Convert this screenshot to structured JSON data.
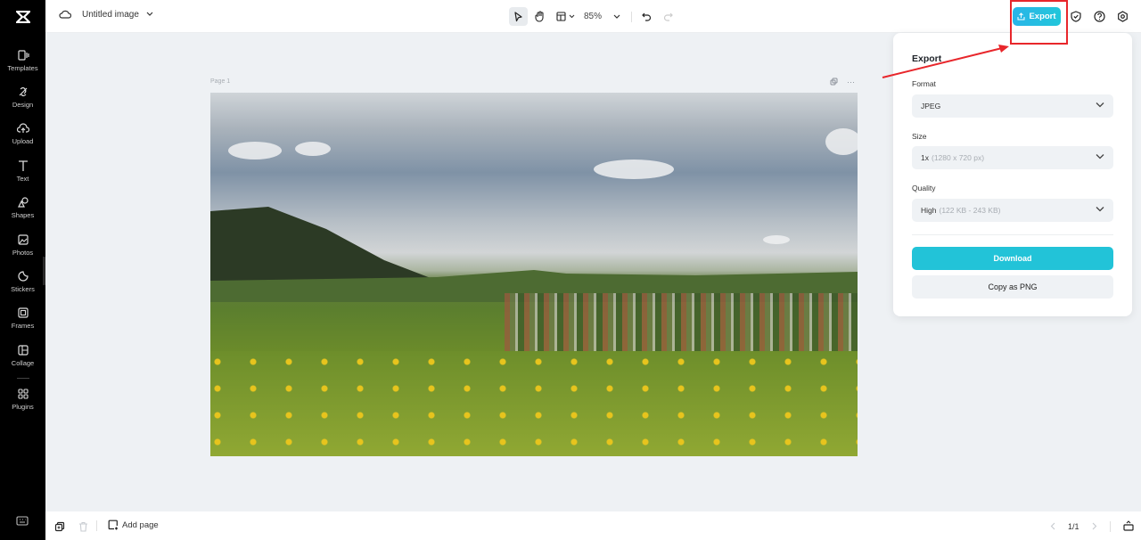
{
  "sidebar": {
    "logo": "capcut-logo",
    "items": [
      {
        "label": "Templates",
        "icon": "templates-icon"
      },
      {
        "label": "Design",
        "icon": "design-icon"
      },
      {
        "label": "Upload",
        "icon": "upload-cloud-icon"
      },
      {
        "label": "Text",
        "icon": "text-icon"
      },
      {
        "label": "Shapes",
        "icon": "shapes-icon"
      },
      {
        "label": "Photos",
        "icon": "photos-icon"
      },
      {
        "label": "Stickers",
        "icon": "stickers-icon"
      },
      {
        "label": "Frames",
        "icon": "frames-icon"
      },
      {
        "label": "Collage",
        "icon": "collage-icon"
      },
      {
        "label": "Plugins",
        "icon": "plugins-icon"
      }
    ]
  },
  "header": {
    "title": "Untitled image",
    "zoom": "85%",
    "export_label": "Export"
  },
  "canvas": {
    "page_label": "Page 1",
    "more": "···"
  },
  "export_panel": {
    "title": "Export",
    "format": {
      "label": "Format",
      "value": "JPEG"
    },
    "size": {
      "label": "Size",
      "value": "1x",
      "detail": "(1280 x 720 px)"
    },
    "quality": {
      "label": "Quality",
      "value": "High",
      "detail": "(122 KB - 243 KB)"
    },
    "download_label": "Download",
    "copy_label": "Copy as PNG"
  },
  "footer": {
    "add_page": "Add page",
    "page_indicator": "1/1"
  },
  "colors": {
    "accent": "#22c3d8",
    "annotation": "#e8262b"
  }
}
